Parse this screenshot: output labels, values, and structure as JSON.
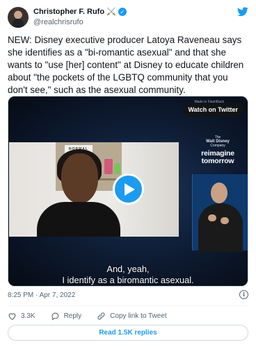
{
  "author": {
    "display_name": "Christopher F. Rufo",
    "emoji": "⚔️",
    "handle": "@realchrisrufo",
    "verified": true
  },
  "tweet": {
    "text": "NEW: Disney executive producer Latoya Raveneau says she identifies as a \"bi-romantic asexual\" and that she wants to \"use [her] content\" at Disney to educate children about \"the pockets of the LGBTQ community that you don't see,\" such as the asexual community."
  },
  "video": {
    "made_for": "Made in FlashBack",
    "watch_label": "Watch on Twitter",
    "sign_text": "NORMAL",
    "brand_small_top": "The",
    "brand_small_line": "Walt Disney",
    "brand_small_bottom": "Company",
    "brand_line1": "reimagine",
    "brand_line2": "tomorrow",
    "caption_line1": "And, yeah,",
    "caption_line2": "I identify as a biromantic asexual."
  },
  "meta": {
    "timestamp": "8:25 PM · Apr 7, 2022",
    "info_symbol": "i"
  },
  "actions": {
    "likes": "3.3K",
    "reply_label": "Reply",
    "copy_label": "Copy link to Tweet"
  },
  "replies_button": "Read 1.5K replies",
  "colors": {
    "accent": "#1d9bf0",
    "text": "#0f1419",
    "secondary": "#536471",
    "border": "#cfd9de"
  }
}
